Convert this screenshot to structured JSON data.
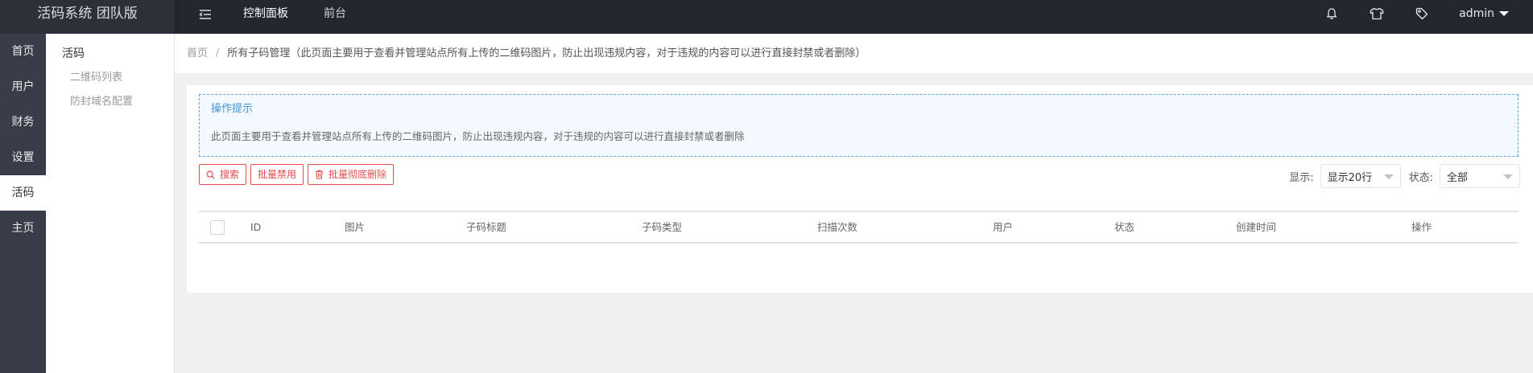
{
  "app": {
    "title": "活码系统 团队版"
  },
  "topnav": {
    "items": [
      {
        "label": "控制面板"
      },
      {
        "label": "前台"
      }
    ]
  },
  "user": {
    "name": "admin"
  },
  "sidebar": {
    "items": [
      {
        "label": "首页"
      },
      {
        "label": "用户"
      },
      {
        "label": "财务"
      },
      {
        "label": "设置"
      },
      {
        "label": "活码"
      },
      {
        "label": "主页"
      }
    ]
  },
  "subnav": {
    "title": "活码",
    "items": [
      {
        "label": "二维码列表"
      },
      {
        "label": "防封域名配置"
      }
    ]
  },
  "breadcrumb": {
    "home": "首页",
    "separator": "/",
    "current": "所有子码管理（此页面主要用于查看并管理站点所有上传的二维码图片，防止出现违规内容，对于违规的内容可以进行直接封禁或者删除）"
  },
  "tips": {
    "title": "操作提示",
    "text": "此页面主要用于查看并管理站点所有上传的二维码图片，防止出现违规内容，对于违规的内容可以进行直接封禁或者删除"
  },
  "toolbar": {
    "search": "搜索",
    "batch_ban": "批量禁用",
    "batch_delete": "批量彻底删除"
  },
  "filters": {
    "display_label": "显示:",
    "display_value": "显示20行",
    "status_label": "状态:",
    "status_value": "全部"
  },
  "table": {
    "columns": [
      "ID",
      "图片",
      "子码标题",
      "子码类型",
      "扫描次数",
      "用户",
      "状态",
      "创建时间",
      "操作"
    ]
  },
  "colors": {
    "topbar": "#23262e",
    "sidebar": "#393d49",
    "accent_red": "#e64b4b",
    "tips_blue": "#3f96dc"
  }
}
